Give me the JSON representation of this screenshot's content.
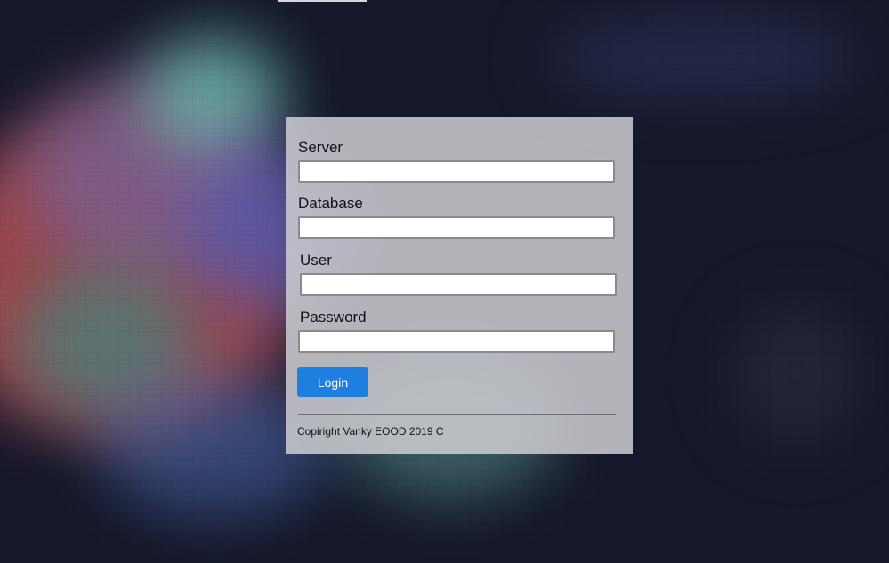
{
  "form": {
    "server": {
      "label": "Server",
      "value": "",
      "placeholder": ""
    },
    "database": {
      "label": "Database",
      "value": "",
      "placeholder": ""
    },
    "user": {
      "label": "User",
      "value": "",
      "placeholder": ""
    },
    "password": {
      "label": "Password",
      "value": "",
      "placeholder": ""
    },
    "login_label": "Login"
  },
  "footer": {
    "copyright": "Copiright Vanky EOOD 2019 C"
  },
  "colors": {
    "button_bg": "#1f7fe1",
    "panel_bg": "#cdcdd2"
  }
}
